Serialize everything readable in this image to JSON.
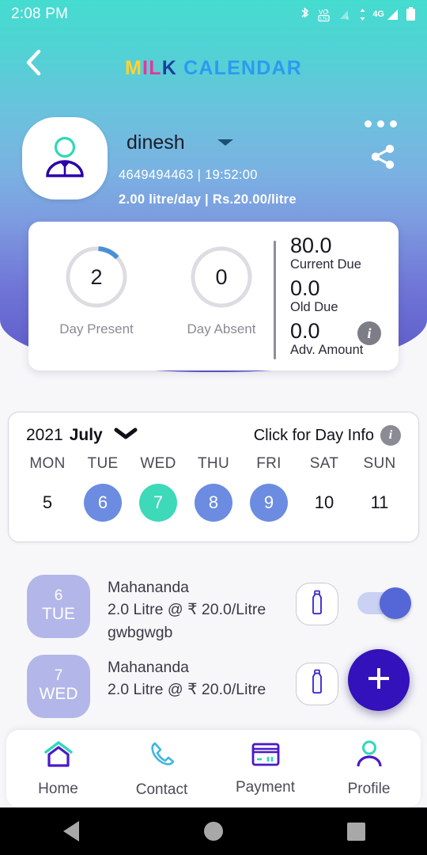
{
  "status_bar": {
    "time": "2:08 PM",
    "network_label": "4G",
    "icons": [
      "bluetooth-icon",
      "volte-icon",
      "sim-no-signal-icon",
      "data-transfer-icon",
      "signal-icon",
      "battery-icon"
    ]
  },
  "header": {
    "back_icon": "back-chevron-icon",
    "title_parts": [
      {
        "text": "M",
        "color": "#ffd233"
      },
      {
        "text": "I",
        "color": "#e8349a"
      },
      {
        "text": "L",
        "color": "#e8349a"
      },
      {
        "text": "K",
        "color": "#1b3fa0"
      }
    ],
    "title_second": "CALENDAR",
    "menu_icon": "more-options-icon",
    "share_icon": "share-icon"
  },
  "profile": {
    "avatar_icon": "user-avatar-icon",
    "name": "dinesh",
    "dropdown_icon": "chevron-down-icon",
    "line1": "4649494463  |  19:52:00",
    "line2": "2.00 litre/day  |  Rs.20.00/litre"
  },
  "stats": {
    "rings": [
      {
        "value": "2",
        "label": "Day Present",
        "progress_pct": 12,
        "arc_color": "#4b8fd6"
      },
      {
        "value": "0",
        "label": "Day Absent",
        "progress_pct": 0,
        "arc_color": "#4b8fd6"
      }
    ],
    "dues": [
      {
        "amount": "80.0",
        "label": "Current Due"
      },
      {
        "amount": "0.0",
        "label": "Old Due"
      },
      {
        "amount": "0.0",
        "label": "Adv. Amount"
      }
    ],
    "info_icon": "info-icon",
    "info_glyph": "i"
  },
  "calendar": {
    "year": "2021",
    "month": "July",
    "month_dropdown_icon": "chevron-down-icon",
    "day_info_text": "Click for Day Info",
    "day_info_icon": "info-icon",
    "day_info_glyph": "i",
    "weekdays": [
      "MON",
      "TUE",
      "WED",
      "THU",
      "FRI",
      "SAT",
      "SUN"
    ],
    "dates": [
      {
        "num": "5",
        "state": "none"
      },
      {
        "num": "6",
        "state": "blue"
      },
      {
        "num": "7",
        "state": "teal"
      },
      {
        "num": "8",
        "state": "blue"
      },
      {
        "num": "9",
        "state": "blue"
      },
      {
        "num": "10",
        "state": "none"
      },
      {
        "num": "11",
        "state": "none"
      }
    ],
    "colors": {
      "blue": "#6b8ce0",
      "teal": "#3dd9b8"
    }
  },
  "deliveries": [
    {
      "day_number": "6",
      "day_name": "TUE",
      "vendor": "Mahananda",
      "quantity": "2.0 Litre @ ₹ 20.0/Litre",
      "note": "gwbgwgb",
      "bottle_icon": "milk-bottle-icon",
      "toggle_on": true
    },
    {
      "day_number": "7",
      "day_name": "WED",
      "vendor": "Mahananda",
      "quantity": "2.0 Litre @ ₹ 20.0/Litre",
      "note": "",
      "bottle_icon": "milk-bottle-icon",
      "toggle_on": false
    }
  ],
  "fab": {
    "icon": "plus-icon",
    "color": "#3311bb"
  },
  "bottom_nav": [
    {
      "label": "Home",
      "icon": "home-icon"
    },
    {
      "label": "Contact",
      "icon": "phone-icon"
    },
    {
      "label": "Payment",
      "icon": "credit-card-icon"
    },
    {
      "label": "Profile",
      "icon": "person-icon"
    }
  ],
  "android_nav": [
    {
      "icon": "back-triangle-icon"
    },
    {
      "icon": "home-circle-icon"
    },
    {
      "icon": "recents-square-icon"
    }
  ]
}
